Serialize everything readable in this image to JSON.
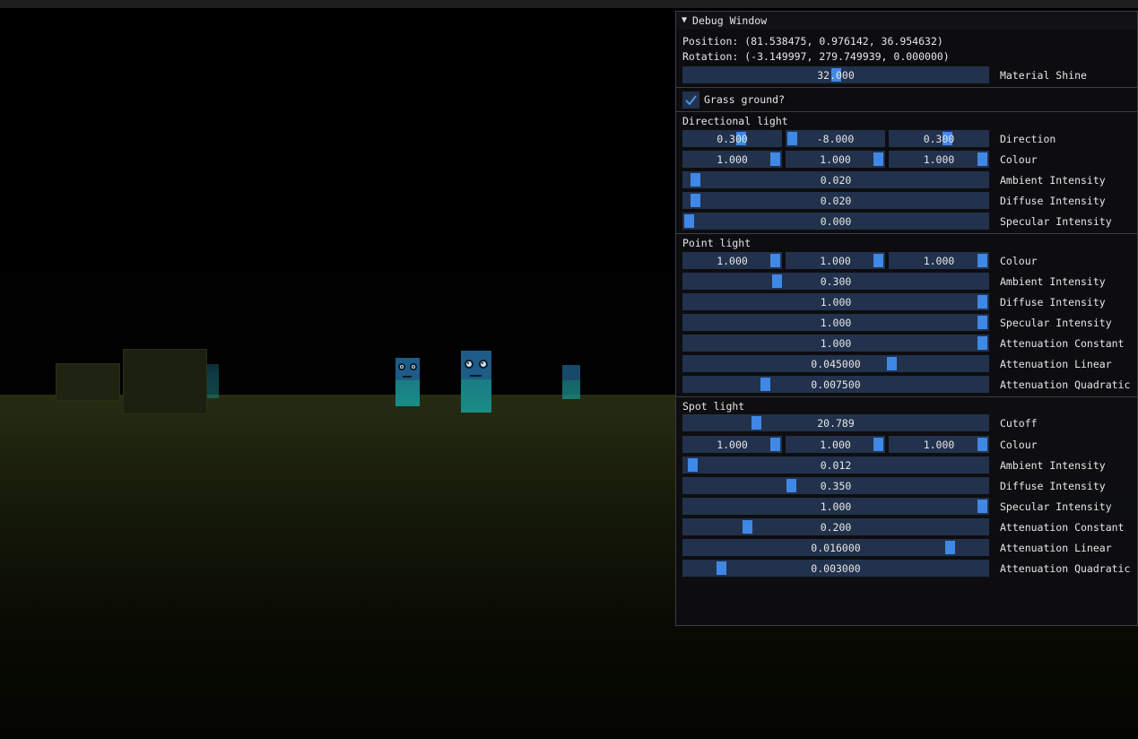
{
  "debug_window": {
    "title": "Debug Window",
    "position_text": "Position: (81.538475, 0.976142, 36.954632)",
    "rotation_text": "Rotation: (-3.149997, 279.749939, 0.000000)",
    "material_shine": {
      "value": "32.000",
      "fraction": 0.5,
      "label": "Material Shine"
    },
    "grass_ground": {
      "label": "Grass ground?",
      "checked": true
    },
    "directional": {
      "header": "Directional light",
      "direction": {
        "values": [
          "0.300",
          "-8.000",
          "0.300"
        ],
        "fractions": [
          0.6,
          0.0,
          0.6
        ],
        "label": "Direction"
      },
      "colour": {
        "values": [
          "1.000",
          "1.000",
          "1.000"
        ],
        "fractions": [
          1,
          1,
          1
        ],
        "label": "Colour"
      },
      "ambient": {
        "value": "0.020",
        "fraction": 0.02,
        "label": "Ambient Intensity"
      },
      "diffuse": {
        "value": "0.020",
        "fraction": 0.02,
        "label": "Diffuse Intensity"
      },
      "specular": {
        "value": "0.000",
        "fraction": 0.0,
        "label": "Specular Intensity"
      }
    },
    "point": {
      "header": "Point light",
      "colour": {
        "values": [
          "1.000",
          "1.000",
          "1.000"
        ],
        "fractions": [
          1,
          1,
          1
        ],
        "label": "Colour"
      },
      "ambient": {
        "value": "0.300",
        "fraction": 0.3,
        "label": "Ambient Intensity"
      },
      "diffuse": {
        "value": "1.000",
        "fraction": 1.0,
        "label": "Diffuse Intensity"
      },
      "specular": {
        "value": "1.000",
        "fraction": 1.0,
        "label": "Specular Intensity"
      },
      "att_constant": {
        "value": "1.000",
        "fraction": 1.0,
        "label": "Attenuation Constant"
      },
      "att_linear": {
        "value": "0.045000",
        "fraction": 0.69,
        "label": "Attenuation Linear"
      },
      "att_quadratic": {
        "value": "0.007500",
        "fraction": 0.26,
        "label": "Attenuation Quadratic"
      }
    },
    "spot": {
      "header": "Spot light",
      "cutoff": {
        "value": "20.789",
        "fraction": 0.23,
        "label": "Cutoff"
      },
      "colour": {
        "values": [
          "1.000",
          "1.000",
          "1.000"
        ],
        "fractions": [
          1,
          1,
          1
        ],
        "label": "Colour"
      },
      "ambient": {
        "value": "0.012",
        "fraction": 0.012,
        "label": "Ambient Intensity"
      },
      "diffuse": {
        "value": "0.350",
        "fraction": 0.35,
        "label": "Diffuse Intensity"
      },
      "specular": {
        "value": "1.000",
        "fraction": 1.0,
        "label": "Specular Intensity"
      },
      "att_constant": {
        "value": "0.200",
        "fraction": 0.2,
        "label": "Attenuation Constant"
      },
      "att_linear": {
        "value": "0.016000",
        "fraction": 0.89,
        "label": "Attenuation Linear"
      },
      "att_quadratic": {
        "value": "0.003000",
        "fraction": 0.11,
        "label": "Attenuation Quadratic"
      }
    }
  },
  "colors": {
    "frame_bg": "#22324d",
    "grab": "#3f88e6",
    "window_bg": "#0e0e11"
  }
}
